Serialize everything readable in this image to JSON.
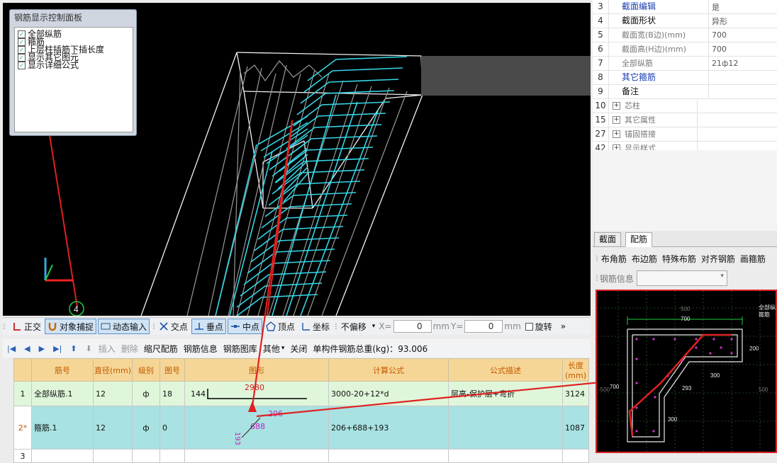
{
  "control_panel": {
    "title": "钢筋显示控制面板",
    "items": [
      {
        "label": "全部纵筋",
        "checked": true
      },
      {
        "label": "箍筋",
        "checked": true
      },
      {
        "label": "上层柱插筋下插长度",
        "checked": true
      },
      {
        "label": "显示其它图元",
        "checked": true
      },
      {
        "label": "显示详细公式",
        "checked": true
      }
    ]
  },
  "viewport": {
    "axis_label": "4",
    "colors": {
      "cyan": "#34d6e6",
      "white": "#f2f2f2",
      "gray": "#9a9a9a",
      "red": "#e02020"
    }
  },
  "snapbar": {
    "ortho": "正交",
    "snap": "对象捕捉",
    "dynamic": "动态输入",
    "intersect": "交点",
    "perp": "垂点",
    "mid": "中点",
    "vertex": "顶点",
    "coord": "坐标",
    "offset": "不偏移",
    "x_label": "X=",
    "x_value": "0",
    "unit": "mm",
    "y_label": "Y=",
    "y_value": "0",
    "unit2": "mm",
    "rotate": "旋转"
  },
  "rebarbar": {
    "insert": "插入",
    "delete": "删除",
    "scale": "缩尺配筋",
    "info": "钢筋信息",
    "lib": "钢筋图库",
    "other": "其他",
    "close": "关闭",
    "total": "单构件钢筋总重(kg)：93.006"
  },
  "table": {
    "headers": [
      "筋号",
      "直径(mm)",
      "级别",
      "图号",
      "图形",
      "计算公式",
      "公式描述",
      "长度(mm)"
    ],
    "rows": [
      {
        "idx": "1",
        "name": "全部纵筋.1",
        "dia": "12",
        "grade": "ф",
        "fig": "18",
        "shape_left": "144",
        "shape_top": "2980",
        "formula": "3000-20+12*d",
        "desc": "层高-保护层+弯折",
        "len": "3124"
      },
      {
        "idx": "2*",
        "name": "箍筋.1",
        "dia": "12",
        "grade": "ф",
        "fig": "0",
        "shape_a": "206",
        "shape_b": "688",
        "shape_c": "193",
        "formula": "206+688+193",
        "desc": "",
        "len": "1087"
      },
      {
        "idx": "3",
        "name": "",
        "dia": "",
        "grade": "",
        "fig": "",
        "formula": "",
        "desc": "",
        "len": ""
      }
    ]
  },
  "properties": [
    {
      "n": "3",
      "k": "截面编辑",
      "v": "是",
      "blue": true
    },
    {
      "n": "4",
      "k": "截面形状",
      "v": "异形"
    },
    {
      "n": "5",
      "k": "截面宽(B边)(mm)",
      "v": "700",
      "gray": true
    },
    {
      "n": "6",
      "k": "截面高(H边)(mm)",
      "v": "700",
      "gray": true
    },
    {
      "n": "7",
      "k": "全部纵筋",
      "v": "21ф12",
      "gray": true
    },
    {
      "n": "8",
      "k": "其它箍筋",
      "v": "",
      "blue": true
    },
    {
      "n": "9",
      "k": "备注",
      "v": ""
    },
    {
      "n": "10",
      "k": "芯柱",
      "v": "",
      "plus": true,
      "gray": true
    },
    {
      "n": "15",
      "k": "其它属性",
      "v": "",
      "plus": true,
      "gray": true
    },
    {
      "n": "27",
      "k": "锚固搭接",
      "v": "",
      "plus": true,
      "gray": true
    },
    {
      "n": "42",
      "k": "显示样式",
      "v": "",
      "plus": true,
      "gray": true
    }
  ],
  "tabs": [
    "截面",
    "配筋"
  ],
  "right_toolbar": [
    "布角筋",
    "布边筋",
    "特殊布筋",
    "对齐钢筋",
    "画箍筋"
  ],
  "rebar_info_label": "钢筋信息",
  "section": {
    "labels": {
      "top": "500",
      "w": "700",
      "r200": "200",
      "r300": "300",
      "d293": "293",
      "l700": "700",
      "b300": "300",
      "left500": "-500",
      "right500": "500",
      "legend1": "全部纵",
      "legend2": "箍筋"
    }
  }
}
